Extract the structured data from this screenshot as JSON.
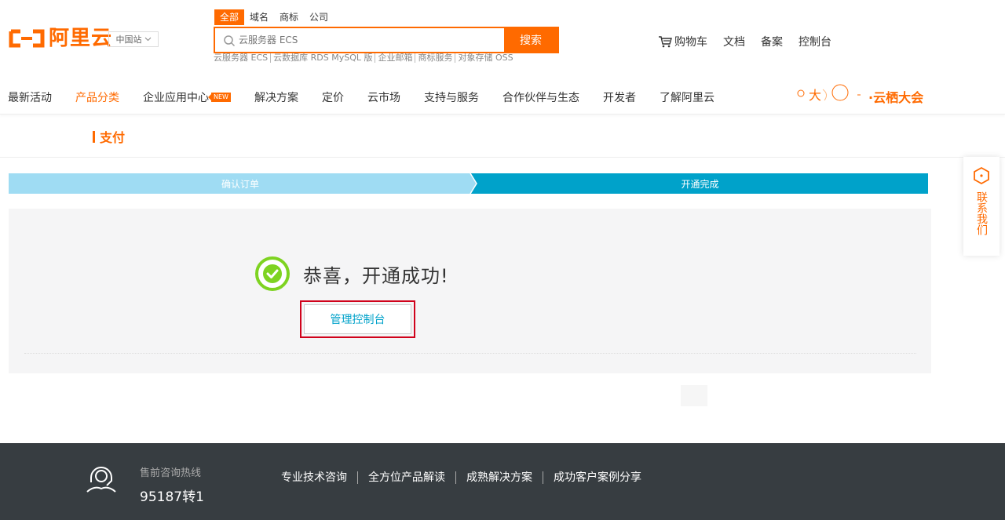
{
  "header": {
    "logo_text": "阿里云",
    "region": "中国站",
    "search": {
      "tabs": [
        "全部",
        "域名",
        "商标",
        "公司"
      ],
      "active_tab": 0,
      "placeholder": "云服务器 ECS",
      "button": "搜索",
      "hot_links": [
        "云服务器 ECS",
        "云数据库 RDS MySQL 版",
        "企业邮箱",
        "商标服务",
        "对象存储 OSS"
      ]
    },
    "right_links": {
      "cart": "购物车",
      "docs": "文档",
      "record": "备案",
      "console": "控制台"
    }
  },
  "nav": {
    "items": [
      {
        "label": "最新活动"
      },
      {
        "label": "产品分类",
        "active": true
      },
      {
        "label": "企业应用中心",
        "badge": "NEW"
      },
      {
        "label": "解决方案"
      },
      {
        "label": "定价"
      },
      {
        "label": "云市场"
      },
      {
        "label": "支持与服务"
      },
      {
        "label": "合作伙伴与生态"
      },
      {
        "label": "开发者"
      },
      {
        "label": "了解阿里云"
      }
    ],
    "promo_text": "·云栖大会"
  },
  "page": {
    "section_title": "支付",
    "steps": [
      "确认订单",
      "开通完成"
    ],
    "success_message": "恭喜，开通成功!",
    "console_button": "管理控制台"
  },
  "side_contact": {
    "label": "联系我们"
  },
  "footer": {
    "hotline_label": "售前咨询热线",
    "hotline_number": "95187转1",
    "links": [
      "专业技术咨询",
      "全方位产品解读",
      "成熟解决方案",
      "成功客户案例分享"
    ]
  },
  "colors": {
    "brand": "#ff6a00",
    "step_done": "#9fdcf3",
    "step_current": "#00a2ca",
    "success_green": "#7ed321",
    "highlight_red": "#d0021b",
    "footer_bg": "#373d41"
  }
}
